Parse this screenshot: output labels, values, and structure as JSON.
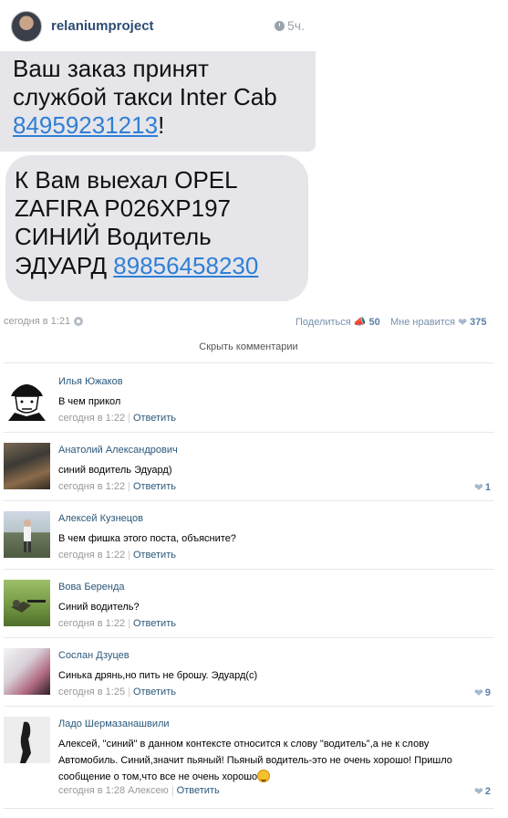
{
  "post_image": {
    "username": "relaniumproject",
    "time": "5ч.",
    "sms1": {
      "line1": "Ваш заказ принят",
      "line2": "службой такси Inter Cab",
      "phone": "84959231213",
      "suffix": "!"
    },
    "sms2": {
      "line1": "К Вам выехал OPEL",
      "line2": "ZAFIRA Р026ХР197",
      "line3": "СИНИЙ Водитель",
      "line4_prefix": "ЭДУАРД ",
      "phone": "89856458230"
    }
  },
  "post_footer": {
    "date": "сегодня в 1:21",
    "share_label": "Поделиться",
    "share_count": "50",
    "like_label": "Мне нравится",
    "like_count": "375"
  },
  "hide_comments_label": "Скрыть комментарии",
  "reply_label": "Ответить",
  "comments": [
    {
      "author": "Илья Южаков",
      "text": "В чем прикол",
      "time": "сегодня в 1:22",
      "likes": ""
    },
    {
      "author": "Анатолий Александрович",
      "text": "синий водитель Эдуард)",
      "time": "сегодня в 1:22",
      "likes": "1"
    },
    {
      "author": "Алексей Кузнецов",
      "text": "В чем фишка этого поста, объясните?",
      "time": "сегодня в 1:22",
      "likes": ""
    },
    {
      "author": "Вова Беренда",
      "text": "Синий водитель?",
      "time": "сегодня в 1:22",
      "likes": ""
    },
    {
      "author": "Сослан Дзуцев",
      "text": "Синька дрянь,но пить не брошу. Эдуард(с)",
      "time": "сегодня в 1:25",
      "likes": "9"
    },
    {
      "author": "Ладо Шермазанашвили",
      "text_line1": "Алексей, \"синий\" в данном контексте относится к слову \"водитель\",а не к слову",
      "text_line2": "Автомобиль. Синий,значит пьяный! Пьяный водитель-это не очень хорошо! Пришло",
      "text_line3": "сообщение о том,что все не очень хорошо",
      "time": "сегодня в 1:28 Алексею",
      "likes": "2"
    }
  ]
}
